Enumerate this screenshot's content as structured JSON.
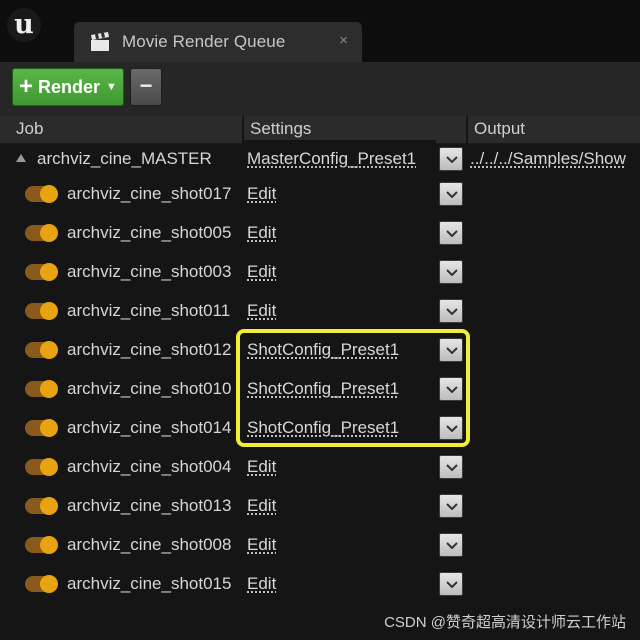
{
  "tab": {
    "title": "Movie Render Queue",
    "close": "×",
    "icon": "clapperboard-icon"
  },
  "logo": {
    "glyph": "u"
  },
  "toolbar": {
    "render_label": "Render",
    "plus": "+",
    "caret": "▼",
    "remove_label": "−"
  },
  "columns": {
    "job": "Job",
    "settings": "Settings",
    "output": "Output"
  },
  "master": {
    "name": "archviz_cine_MASTER",
    "settings": "MasterConfig_Preset1",
    "output": "../../../Samples/Show"
  },
  "shots": [
    {
      "name": "archviz_cine_shot017",
      "settings": "Edit"
    },
    {
      "name": "archviz_cine_shot005",
      "settings": "Edit"
    },
    {
      "name": "archviz_cine_shot003",
      "settings": "Edit"
    },
    {
      "name": "archviz_cine_shot011",
      "settings": "Edit"
    },
    {
      "name": "archviz_cine_shot012",
      "settings": "ShotConfig_Preset1"
    },
    {
      "name": "archviz_cine_shot010",
      "settings": "ShotConfig_Preset1"
    },
    {
      "name": "archviz_cine_shot014",
      "settings": "ShotConfig_Preset1"
    },
    {
      "name": "archviz_cine_shot004",
      "settings": "Edit"
    },
    {
      "name": "archviz_cine_shot013",
      "settings": "Edit"
    },
    {
      "name": "archviz_cine_shot008",
      "settings": "Edit"
    },
    {
      "name": "archviz_cine_shot015",
      "settings": "Edit"
    }
  ],
  "colors": {
    "toggle_on": "#e7a310",
    "render_green": "#4aa83b",
    "highlight": "#f2ee34"
  },
  "watermark": "CSDN @赞奇超高清设计师云工作站"
}
